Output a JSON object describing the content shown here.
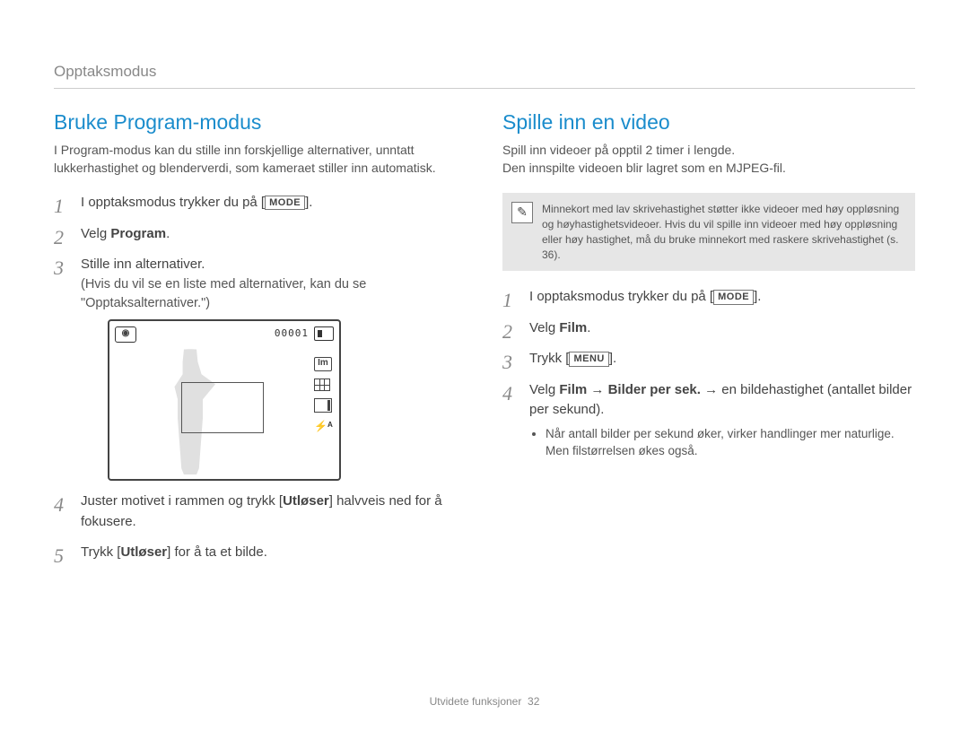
{
  "breadcrumb": "Opptaksmodus",
  "left": {
    "title": "Bruke Program-modus",
    "intro": "I Program-modus kan du stille inn forskjellige alternativer, unntatt lukkerhastighet og blenderverdi, som kameraet stiller inn automatisk.",
    "step1_pre": "I opptaksmodus trykker du på [",
    "step1_btn": "MODE",
    "step1_post": "].",
    "step2_pre": "Velg ",
    "step2_bold": "Program",
    "step2_post": ".",
    "step3_line1": "Stille inn alternativer.",
    "step3_line2": "(Hvis du vil se en liste med alternativer, kan du se \"Opptaksalternativer.\")",
    "diagram": {
      "counter": "00001",
      "im_label": "Im",
      "flash_label": "⚡ᴬ"
    },
    "step4_pre": "Juster motivet i rammen og trykk [",
    "step4_bold": "Utløser",
    "step4_post": "] halvveis ned for å fokusere.",
    "step5_pre": "Trykk [",
    "step5_bold": "Utløser",
    "step5_post": "] for å ta et bilde."
  },
  "right": {
    "title": "Spille inn en video",
    "intro_line1": "Spill inn videoer på opptil 2 timer i lengde.",
    "intro_line2": "Den innspilte videoen blir lagret som en MJPEG-fil.",
    "note_icon": "✎",
    "note": "Minnekort med lav skrivehastighet støtter ikke videoer med høy oppløsning og høyhastighetsvideoer. Hvis du vil spille inn videoer med høy oppløsning eller høy hastighet, må du bruke minnekort med raskere skrivehastighet (s. 36).",
    "step1_pre": "I opptaksmodus trykker du på [",
    "step1_btn": "MODE",
    "step1_post": "].",
    "step2_pre": "Velg ",
    "step2_bold": "Film",
    "step2_post": ".",
    "step3_pre": "Trykk [",
    "step3_btn": "MENU",
    "step3_post": "].",
    "step4_pre": "Velg ",
    "step4_b1": "Film",
    "step4_arrow1": " → ",
    "step4_b2": "Bilder per sek.",
    "step4_arrow2": " → ",
    "step4_post": "en bildehastighet (antallet bilder per sekund).",
    "step4_bullet": "Når antall bilder per sekund øker, virker handlinger mer naturlige. Men filstørrelsen økes også."
  },
  "footer_text": "Utvidete funksjoner",
  "footer_page": "32"
}
